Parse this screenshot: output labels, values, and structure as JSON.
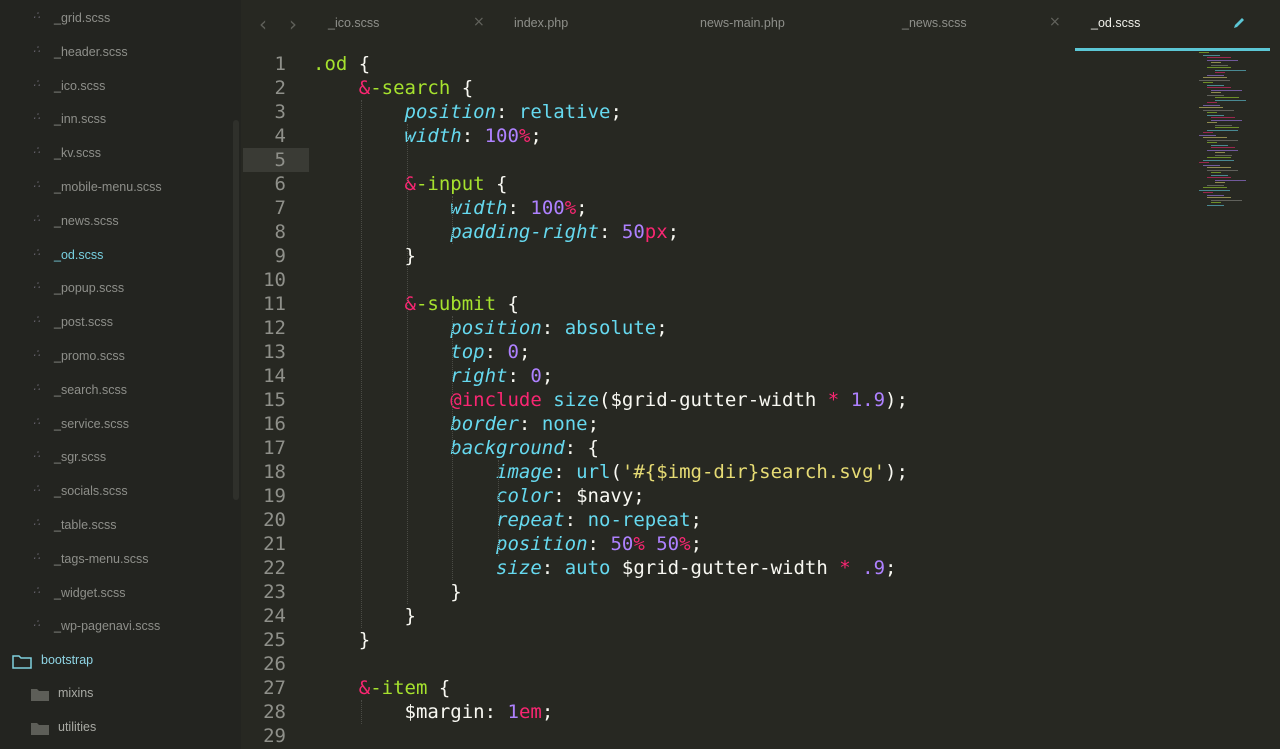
{
  "sidebar": {
    "files": [
      {
        "name": "_grid.scss",
        "active": false
      },
      {
        "name": "_header.scss",
        "active": false
      },
      {
        "name": "_ico.scss",
        "active": false
      },
      {
        "name": "_inn.scss",
        "active": false
      },
      {
        "name": "_kv.scss",
        "active": false
      },
      {
        "name": "_mobile-menu.scss",
        "active": false
      },
      {
        "name": "_news.scss",
        "active": false
      },
      {
        "name": "_od.scss",
        "active": true
      },
      {
        "name": "_popup.scss",
        "active": false
      },
      {
        "name": "_post.scss",
        "active": false
      },
      {
        "name": "_promo.scss",
        "active": false
      },
      {
        "name": "_search.scss",
        "active": false
      },
      {
        "name": "_service.scss",
        "active": false
      },
      {
        "name": "_sgr.scss",
        "active": false
      },
      {
        "name": "_socials.scss",
        "active": false
      },
      {
        "name": "_table.scss",
        "active": false
      },
      {
        "name": "_tags-menu.scss",
        "active": false
      },
      {
        "name": "_widget.scss",
        "active": false
      },
      {
        "name": "_wp-pagenavi.scss",
        "active": false
      }
    ],
    "folders": [
      {
        "name": "bootstrap",
        "open": true
      },
      {
        "name": "mixins",
        "open": false
      },
      {
        "name": "utilities",
        "open": false
      }
    ]
  },
  "tabs": [
    {
      "label": "_ico.scss",
      "active": false,
      "closable": true
    },
    {
      "label": "index.php",
      "active": false,
      "closable": false
    },
    {
      "label": "news-main.php",
      "active": false,
      "closable": false
    },
    {
      "label": "_news.scss",
      "active": false,
      "closable": true
    },
    {
      "label": "_od.scss",
      "active": true,
      "closable": false
    }
  ],
  "editor": {
    "current_line": 5,
    "line_numbers": [
      "1",
      "2",
      "3",
      "4",
      "5",
      "6",
      "7",
      "8",
      "9",
      "10",
      "11",
      "12",
      "13",
      "14",
      "15",
      "16",
      "17",
      "18",
      "19",
      "20",
      "21",
      "22",
      "23",
      "24",
      "25",
      "26",
      "27",
      "28",
      "29"
    ],
    "lines": [
      [
        [
          ".od",
          "sel"
        ],
        [
          " {",
          "plain"
        ]
      ],
      [
        [
          "    ",
          "plain"
        ],
        [
          "&",
          "amp"
        ],
        [
          "-search",
          "sel"
        ],
        [
          " {",
          "plain"
        ]
      ],
      [
        [
          "        ",
          "plain"
        ],
        [
          "position",
          "prop"
        ],
        [
          ": ",
          "plain"
        ],
        [
          "relative",
          "val"
        ],
        [
          ";",
          "plain"
        ]
      ],
      [
        [
          "        ",
          "plain"
        ],
        [
          "width",
          "prop"
        ],
        [
          ": ",
          "plain"
        ],
        [
          "100",
          "num"
        ],
        [
          "%",
          "unit"
        ],
        [
          ";",
          "plain"
        ]
      ],
      [],
      [
        [
          "        ",
          "plain"
        ],
        [
          "&",
          "amp"
        ],
        [
          "-input",
          "sel"
        ],
        [
          " {",
          "plain"
        ]
      ],
      [
        [
          "            ",
          "plain"
        ],
        [
          "width",
          "prop"
        ],
        [
          ": ",
          "plain"
        ],
        [
          "100",
          "num"
        ],
        [
          "%",
          "unit"
        ],
        [
          ";",
          "plain"
        ]
      ],
      [
        [
          "            ",
          "plain"
        ],
        [
          "padding-right",
          "prop"
        ],
        [
          ": ",
          "plain"
        ],
        [
          "50",
          "num"
        ],
        [
          "px",
          "unit"
        ],
        [
          ";",
          "plain"
        ]
      ],
      [
        [
          "        ",
          "plain"
        ],
        [
          "}",
          "plain"
        ]
      ],
      [],
      [
        [
          "        ",
          "plain"
        ],
        [
          "&",
          "amp"
        ],
        [
          "-submit",
          "sel"
        ],
        [
          " {",
          "plain"
        ]
      ],
      [
        [
          "            ",
          "plain"
        ],
        [
          "position",
          "prop"
        ],
        [
          ": ",
          "plain"
        ],
        [
          "absolute",
          "val"
        ],
        [
          ";",
          "plain"
        ]
      ],
      [
        [
          "            ",
          "plain"
        ],
        [
          "top",
          "prop"
        ],
        [
          ": ",
          "plain"
        ],
        [
          "0",
          "num"
        ],
        [
          ";",
          "plain"
        ]
      ],
      [
        [
          "            ",
          "plain"
        ],
        [
          "right",
          "prop"
        ],
        [
          ": ",
          "plain"
        ],
        [
          "0",
          "num"
        ],
        [
          ";",
          "plain"
        ]
      ],
      [
        [
          "            ",
          "plain"
        ],
        [
          "@include",
          "kw"
        ],
        [
          " ",
          "plain"
        ],
        [
          "size",
          "val"
        ],
        [
          "($grid-gutter-width ",
          "plain"
        ],
        [
          "*",
          "op"
        ],
        [
          " ",
          "plain"
        ],
        [
          "1.9",
          "num"
        ],
        [
          ");",
          "plain"
        ]
      ],
      [
        [
          "            ",
          "plain"
        ],
        [
          "border",
          "prop"
        ],
        [
          ": ",
          "plain"
        ],
        [
          "none",
          "val"
        ],
        [
          ";",
          "plain"
        ]
      ],
      [
        [
          "            ",
          "plain"
        ],
        [
          "background",
          "prop"
        ],
        [
          ": {",
          "plain"
        ]
      ],
      [
        [
          "                ",
          "plain"
        ],
        [
          "image",
          "prop"
        ],
        [
          ": ",
          "plain"
        ],
        [
          "url",
          "val"
        ],
        [
          "(",
          "plain"
        ],
        [
          "'#{$img-dir}search.svg'",
          "str"
        ],
        [
          ");",
          "plain"
        ]
      ],
      [
        [
          "                ",
          "plain"
        ],
        [
          "color",
          "prop"
        ],
        [
          ": $navy;",
          "plain"
        ]
      ],
      [
        [
          "                ",
          "plain"
        ],
        [
          "repeat",
          "prop"
        ],
        [
          ": ",
          "plain"
        ],
        [
          "no-repeat",
          "val"
        ],
        [
          ";",
          "plain"
        ]
      ],
      [
        [
          "                ",
          "plain"
        ],
        [
          "position",
          "prop"
        ],
        [
          ": ",
          "plain"
        ],
        [
          "50",
          "num"
        ],
        [
          "%",
          "unit"
        ],
        [
          " ",
          "plain"
        ],
        [
          "50",
          "num"
        ],
        [
          "%",
          "unit"
        ],
        [
          ";",
          "plain"
        ]
      ],
      [
        [
          "                ",
          "plain"
        ],
        [
          "size",
          "prop"
        ],
        [
          ": ",
          "plain"
        ],
        [
          "auto",
          "val"
        ],
        [
          " $grid-gutter-width ",
          "plain"
        ],
        [
          "*",
          "op"
        ],
        [
          " ",
          "plain"
        ],
        [
          ".9",
          "num"
        ],
        [
          ";",
          "plain"
        ]
      ],
      [
        [
          "            ",
          "plain"
        ],
        [
          "}",
          "plain"
        ]
      ],
      [
        [
          "        ",
          "plain"
        ],
        [
          "}",
          "plain"
        ]
      ],
      [
        [
          "    ",
          "plain"
        ],
        [
          "}",
          "plain"
        ]
      ],
      [],
      [
        [
          "    ",
          "plain"
        ],
        [
          "&",
          "amp"
        ],
        [
          "-item",
          "sel"
        ],
        [
          " {",
          "plain"
        ]
      ],
      [
        [
          "        ",
          "plain"
        ],
        [
          "$margin",
          "plain"
        ],
        [
          ": ",
          "plain"
        ],
        [
          "1",
          "num"
        ],
        [
          "em",
          "unit"
        ],
        [
          ";",
          "plain"
        ]
      ],
      []
    ]
  }
}
